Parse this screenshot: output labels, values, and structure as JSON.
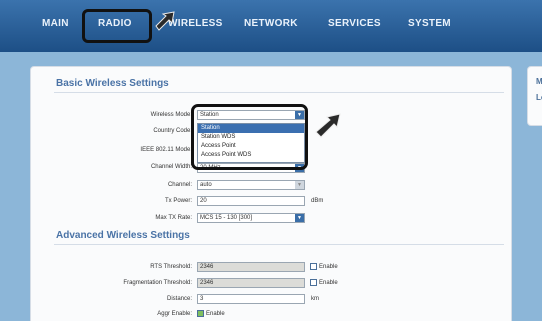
{
  "nav": {
    "items": [
      "MAIN",
      "RADIO",
      "WIRELESS",
      "NETWORK",
      "SERVICES",
      "SYSTEM"
    ]
  },
  "side_panel": {
    "lines": [
      "M",
      "Lo"
    ]
  },
  "basic": {
    "title": "Basic Wireless Settings",
    "wireless_mode_label": "Wireless Mode:",
    "wireless_mode_value": "Station",
    "country_code_label": "Country Code:",
    "ieee_mode_label": "IEEE 802.11 Mode:",
    "channel_width_label": "Channel Width:",
    "channel_width_value": "20 MHz",
    "channel_label": "Channel:",
    "channel_value": "auto",
    "tx_power_label": "Tx Power:",
    "tx_power_value": "20",
    "tx_power_unit": "dBm",
    "max_tx_rate_label": "Max TX Rate:",
    "max_tx_rate_value": "MCS 15 - 130 [300]"
  },
  "dropdown": {
    "options": [
      "Station",
      "Station WDS",
      "Access Point",
      "Access Point WDS"
    ],
    "selected_index": 0
  },
  "advanced": {
    "title": "Advanced Wireless Settings",
    "rts_label": "RTS Threshold:",
    "rts_value": "2346",
    "rts_enable_label": "Enable",
    "frag_label": "Fragmentation Threshold:",
    "frag_value": "2346",
    "frag_enable_label": "Enable",
    "distance_label": "Distance:",
    "distance_value": "3",
    "distance_unit": "km",
    "aggr_label": "Aggr Enable:",
    "aggr_enable_label": "Enable",
    "aggr_checked": true
  },
  "colors": {
    "nav_bg": "#1d4f86",
    "page_bg": "#8cb6d8",
    "section_title": "#4a73a6",
    "dropdown_highlight": "#3b6fb0",
    "annotation": "#111111"
  },
  "icons": {
    "select_arrow": "chevron-down-icon",
    "annotation_arrow": "arrow-icon"
  }
}
